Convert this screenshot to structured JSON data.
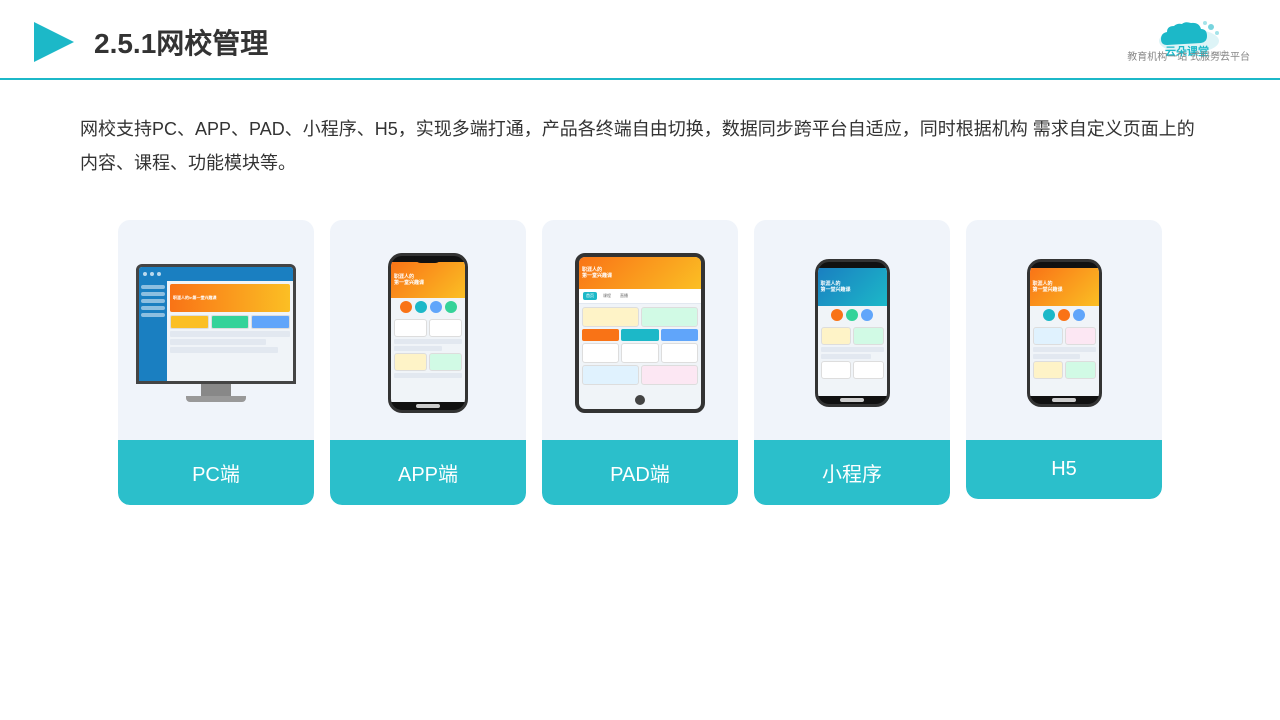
{
  "header": {
    "title": "2.5.1网校管理",
    "logo_name": "云朵课堂",
    "logo_url": "yunduoketang.com",
    "logo_sub": "教育机构一站\n式服务云平台"
  },
  "description": "网校支持PC、APP、PAD、小程序、H5，实现多端打通，产品各终端自由切换，数据同步跨平台自适应，同时根据机构\n需求自定义页面上的内容、课程、功能模块等。",
  "cards": [
    {
      "id": "pc",
      "label": "PC端"
    },
    {
      "id": "app",
      "label": "APP端"
    },
    {
      "id": "pad",
      "label": "PAD端"
    },
    {
      "id": "miniprogram",
      "label": "小程序"
    },
    {
      "id": "h5",
      "label": "H5"
    }
  ],
  "accent_color": "#2bbfcb",
  "brand_color": "#1cb8c8"
}
